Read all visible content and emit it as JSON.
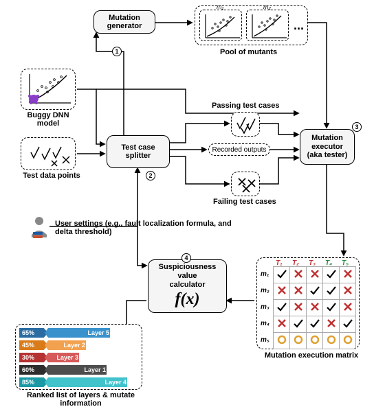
{
  "nodes": {
    "mutation_generator": "Mutation generator",
    "pool_of_mutants": "Pool of mutants",
    "buggy_dnn_model": "Buggy DNN model",
    "test_data_points": "Test data points",
    "test_case_splitter": "Test case splitter",
    "passing_test_cases": "Passing test cases",
    "recorded_outputs": "Recorded outputs",
    "failing_test_cases": "Failing test cases",
    "mutation_executor_l1": "Mutation",
    "mutation_executor_l2": "executor",
    "mutation_executor_l3": "(aka tester)",
    "user_settings": "User settings (e.g., fault localization formula, and delta threshold)",
    "svc_l1": "Suspiciousness value",
    "svc_l2": "calculator",
    "svc_fx": "f(x)",
    "mutation_matrix": "Mutation execution matrix",
    "ranked_list_l1": "Ranked list of layers & mutate",
    "ranked_list_l2": "information",
    "ellipsis": "..."
  },
  "step_markers": {
    "s1": "1",
    "s2": "2",
    "s3": "3",
    "s4": "4"
  },
  "mutant_labels": [
    "m₁",
    "m₂"
  ],
  "ranked": [
    {
      "pct": "65%",
      "tier_color": "#2b6ca3",
      "bar_color": "#3a92cc",
      "len": 95,
      "label": "Layer 5"
    },
    {
      "pct": "45%",
      "tier_color": "#d97b18",
      "bar_color": "#f2a24e",
      "len": 60,
      "label": "Layer 2"
    },
    {
      "pct": "30%",
      "tier_color": "#b53232",
      "bar_color": "#d65a5a",
      "len": 50,
      "label": "Layer 3"
    },
    {
      "pct": "60%",
      "tier_color": "#2d2d2d",
      "bar_color": "#4d4d4d",
      "len": 90,
      "label": "Layer 1"
    },
    {
      "pct": "85%",
      "tier_color": "#1b9aa5",
      "bar_color": "#41c3cc",
      "len": 120,
      "label": "Layer 4"
    }
  ],
  "matrix": {
    "columns": [
      "T₁",
      "T₂",
      "T₃",
      "T₄",
      "T₅"
    ],
    "col_styles": [
      "red",
      "red",
      "red",
      "green",
      "green"
    ],
    "rows": [
      "m₁",
      "m₂",
      "m₃",
      "m₄",
      "m₅"
    ],
    "cells": [
      [
        "tick",
        "cross",
        "cross",
        "tick",
        "cross"
      ],
      [
        "cross",
        "cross",
        "tick",
        "tick",
        "cross"
      ],
      [
        "tick",
        "cross",
        "cross",
        "tick",
        "cross"
      ],
      [
        "cross",
        "tick",
        "tick",
        "cross",
        "tick"
      ],
      [
        "circle",
        "circle",
        "circle",
        "circle",
        "circle"
      ]
    ]
  }
}
